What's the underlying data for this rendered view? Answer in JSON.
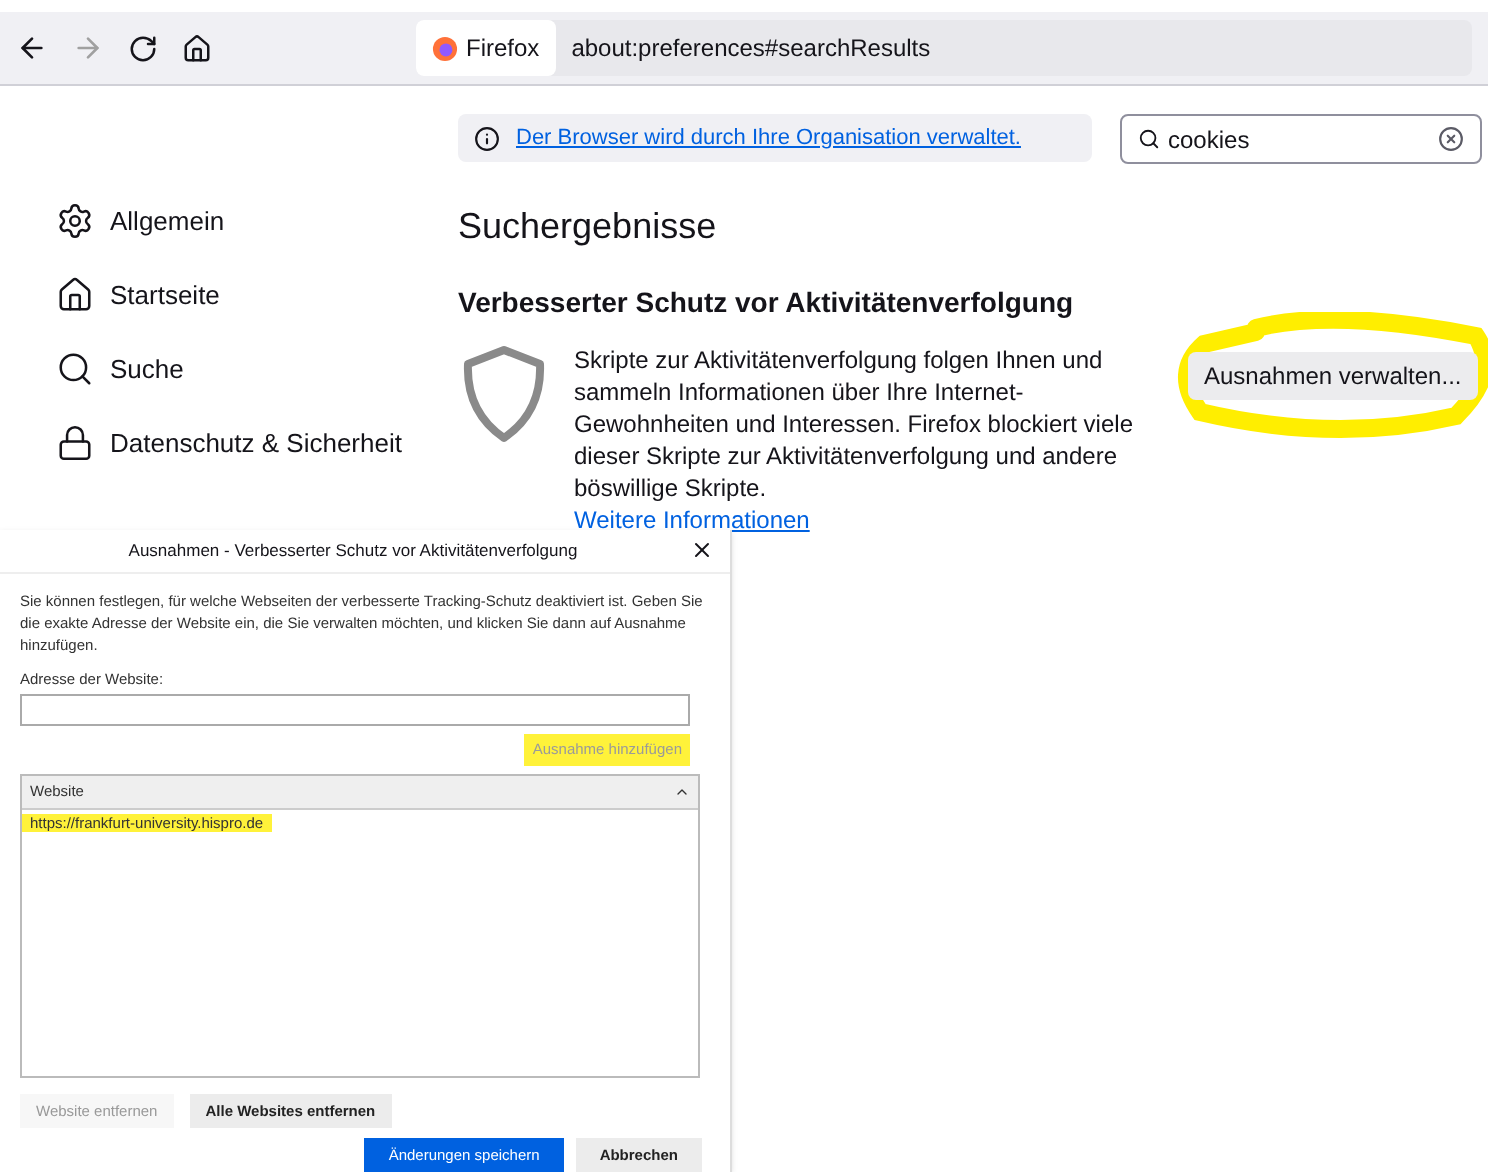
{
  "toolbar": {
    "identity_label": "Firefox",
    "url": "about:preferences#searchResults",
    "forward_disabled": true
  },
  "notice": {
    "text": "Der Browser wird durch Ihre Organisation verwaltet."
  },
  "search": {
    "value": "cookies"
  },
  "sidebar": {
    "items": [
      {
        "kind": "gear",
        "label": "Allgemein"
      },
      {
        "kind": "home",
        "label": "Startseite"
      },
      {
        "kind": "search",
        "label": "Suche"
      },
      {
        "kind": "lock",
        "label": "Datenschutz & Sicherheit"
      }
    ]
  },
  "results": {
    "heading": "Suchergebnisse",
    "section_title": "Verbesserter Schutz vor Aktivitätenverfolgung",
    "description": "Skripte zur Aktivitätenverfolgung folgen Ihnen und sammeln Informationen über Ihre Internet-Gewohnheiten und Interessen. Firefox blockiert viele dieser Skripte zur Aktivitätenverfolgung und andere böswillige Skripte.",
    "link": "Weitere Informationen",
    "button": {
      "label": "Ausnahmen verwalten...",
      "highlighted": true
    }
  },
  "dialog": {
    "title": "Ausnahmen - Verbesserter Schutz vor Aktivitätenverfolgung",
    "intro": "Sie können festlegen, für welche Webseiten der verbesserte Tracking-Schutz deaktiviert ist. Geben Sie die exakte Adresse der Website ein, die Sie verwalten möchten, und klicken Sie dann auf Ausnahme hinzufügen.",
    "address_label": "Adresse der Website:",
    "add_button": {
      "label": "Ausnahme hinzufügen",
      "disabled": true,
      "highlighted": true
    },
    "table": {
      "column": "Website",
      "rows": [
        {
          "site": "https://frankfurt-university.hispro.de",
          "highlighted": true
        }
      ]
    },
    "buttons": [
      {
        "label": "Website entfernen",
        "disabled": true,
        "primary": false
      },
      {
        "label": "Alle Websites entfernen",
        "disabled": false,
        "primary": false
      }
    ],
    "footer_buttons": [
      {
        "label": "Änderungen speichern",
        "primary": true
      },
      {
        "label": "Abbrechen",
        "primary": false
      }
    ]
  }
}
